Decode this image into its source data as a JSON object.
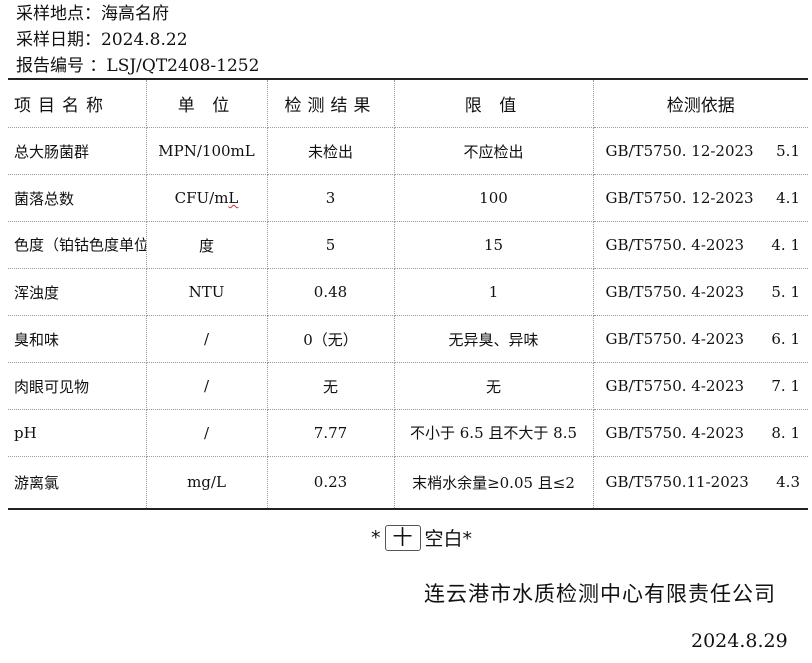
{
  "header": {
    "location": "采样地点：海高名府",
    "date": "采样日期：2024.8.22",
    "report_no": "报告编号 ：LSJ/QT2408-1252"
  },
  "table": {
    "columns": [
      "项目名称",
      "单 位",
      "检测结果",
      "限 值",
      "检测依据"
    ],
    "rows": [
      {
        "item": "总大肠菌群",
        "unit": "MPN/100mL",
        "result": "未检出",
        "limit": "不应检出",
        "method": "GB/T5750. 12-2023",
        "clause": "5.1"
      },
      {
        "item": "菌落总数",
        "unit_pre": "CFU/m",
        "unit_mark": "L",
        "result": "3",
        "limit": "100",
        "method": "GB/T5750. 12-2023",
        "clause": "4.1"
      },
      {
        "item": "色度（铂钴色度单位）",
        "unit": "度",
        "result": "5",
        "limit": "15",
        "method": "GB/T5750. 4-2023",
        "clause": "4. 1"
      },
      {
        "item": "浑浊度",
        "unit": "NTU",
        "result": "0.48",
        "limit": "1",
        "method": "GB/T5750. 4-2023",
        "clause": "5. 1"
      },
      {
        "item": "臭和味",
        "unit": "/",
        "result": "0（无）",
        "limit": "无异臭、异味",
        "method": "GB/T5750. 4-2023",
        "clause": "6. 1"
      },
      {
        "item": "肉眼可见物",
        "unit": "/",
        "result": "无",
        "limit": "无",
        "method": "GB/T5750. 4-2023",
        "clause": "7. 1"
      },
      {
        "item": "pH",
        "unit": "/",
        "result": "7.77",
        "limit": "不小于 6.5 且不大于 8.5",
        "method": "GB/T5750. 4-2023",
        "clause": "8. 1"
      },
      {
        "item": "游离氯",
        "unit": "mg/L",
        "result": "0.23",
        "limit": "末梢水余量≥0.05 且≤2",
        "method": "GB/T5750.11-2023",
        "clause": "4.3"
      }
    ]
  },
  "blank_note": {
    "left": "*",
    "symbol": "十",
    "text": "空白*"
  },
  "footer": {
    "company": "连云港市水质检测中心有限责任公司",
    "date": "2024.8.29"
  }
}
